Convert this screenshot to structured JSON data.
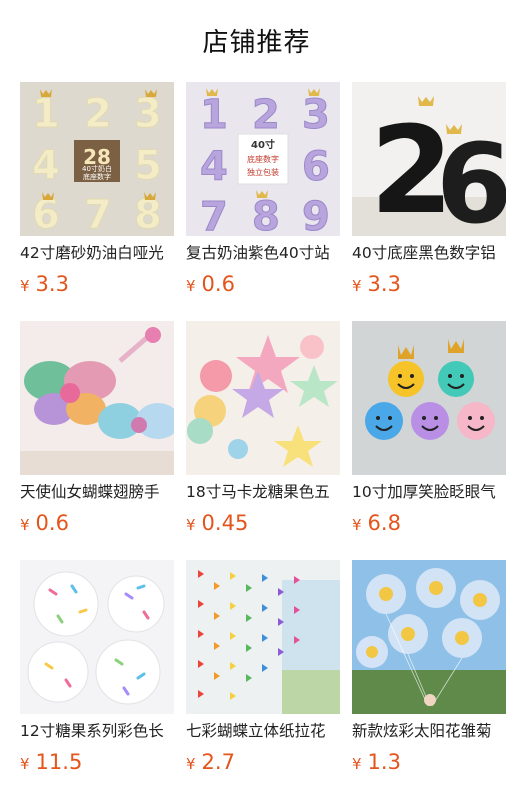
{
  "page": {
    "title": "店铺推荐"
  },
  "currency": "¥",
  "products": [
    {
      "name": "42寸磨砂奶油白哑光",
      "price": "3.3",
      "thumb_icon": "cream-number-balloons-icon",
      "thumb_text": [
        "40寸奶白",
        "底座数字"
      ]
    },
    {
      "name": "复古奶油紫色40寸站",
      "price": "0.6",
      "thumb_icon": "purple-number-balloons-icon",
      "thumb_text": [
        "40寸",
        "底座数字",
        "独立包装"
      ]
    },
    {
      "name": "40寸底座黑色数字铝",
      "price": "3.3",
      "thumb_icon": "black-number-balloons-icon"
    },
    {
      "name": "天使仙女蝴蝶翅膀手",
      "price": "0.6",
      "thumb_icon": "butterfly-wing-balloons-icon"
    },
    {
      "name": "18寸马卡龙糖果色五",
      "price": "0.45",
      "thumb_icon": "macaron-star-balloons-icon"
    },
    {
      "name": "10寸加厚笑脸眨眼气",
      "price": "6.8",
      "thumb_icon": "smiley-face-balloons-icon"
    },
    {
      "name": "12寸糖果系列彩色长",
      "price": "11.5",
      "thumb_icon": "confetti-balloons-icon"
    },
    {
      "name": "七彩蝴蝶立体纸拉花",
      "price": "2.7",
      "thumb_icon": "paper-butterfly-garland-icon"
    },
    {
      "name": "新款炫彩太阳花雏菊",
      "price": "1.3",
      "thumb_icon": "daisy-flower-balloons-icon"
    }
  ],
  "colors": {
    "price": "#e4541b",
    "title": "#111111"
  }
}
